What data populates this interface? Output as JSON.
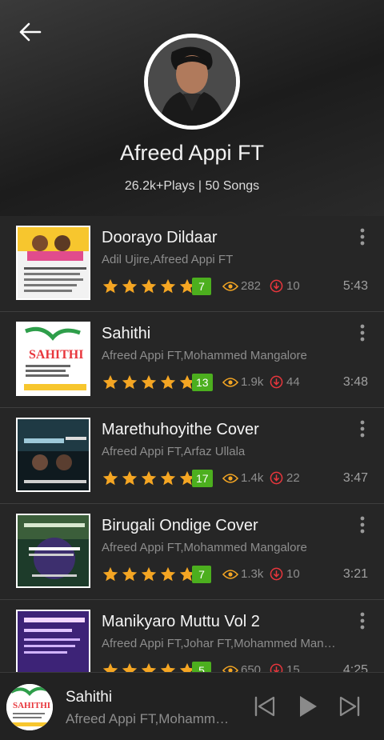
{
  "artist": {
    "name": "Afreed Appi FT",
    "stats": "26.2k+Plays | 50 Songs"
  },
  "icons": {
    "back": "back-arrow-icon",
    "more": "more-vertical-icon",
    "star": "star-icon",
    "views": "eye-icon",
    "downloads": "download-circle-icon",
    "previous": "skip-previous-icon",
    "play": "play-icon",
    "next": "skip-next-icon"
  },
  "colors": {
    "background": "#262626",
    "star": "#f5a623",
    "badge": "#4caf1e",
    "download": "#e8363c"
  },
  "songs": [
    {
      "title": "Doorayo Dildaar",
      "artists": "Adil Ujire,Afreed Appi FT",
      "rating": "7",
      "views": "282",
      "downloads": "10",
      "duration": "5:43"
    },
    {
      "title": "Sahithi",
      "artists": "Afreed Appi FT,Mohammed Mangalore",
      "rating": "13",
      "views": "1.9k",
      "downloads": "44",
      "duration": "3:48"
    },
    {
      "title": "Marethuhoyithe Cover",
      "artists": "Afreed Appi FT,Arfaz Ullala",
      "rating": "17",
      "views": "1.4k",
      "downloads": "22",
      "duration": "3:47"
    },
    {
      "title": "Birugali Ondige Cover",
      "artists": "Afreed Appi FT,Mohammed Mangalore",
      "rating": "7",
      "views": "1.3k",
      "downloads": "10",
      "duration": "3:21"
    },
    {
      "title": "Manikyaro Muttu Vol 2",
      "artists": "Afreed Appi FT,Johar FT,Mohammed Mangalore",
      "rating": "5",
      "views": "650",
      "downloads": "15",
      "duration": "4:25"
    }
  ],
  "player": {
    "title": "Sahithi",
    "artist": "Afreed Appi FT,Mohammed Mangalore"
  }
}
